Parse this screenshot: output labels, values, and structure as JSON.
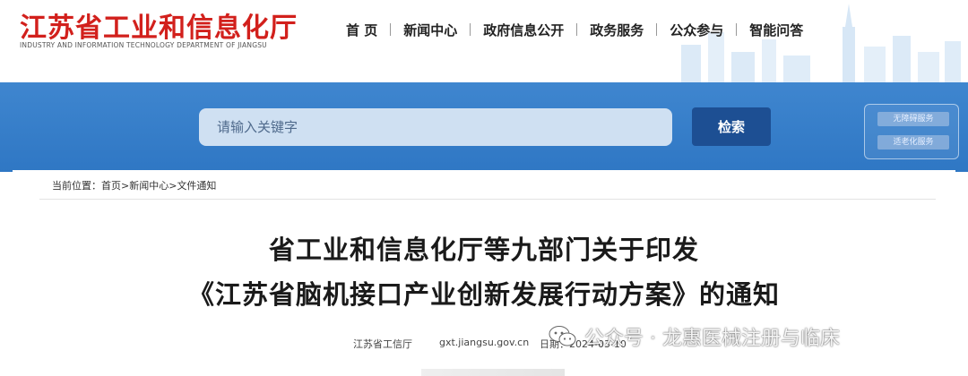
{
  "header": {
    "site_title": "江苏省工业和信息化厅",
    "site_subtitle": "INDUSTRY AND INFORMATION TECHNOLOGY DEPARTMENT OF JIANGSU",
    "nav": [
      "首 页",
      "新闻中心",
      "政府信息公开",
      "政务服务",
      "公众参与",
      "智能问答"
    ]
  },
  "search": {
    "placeholder": "请输入关键字",
    "button_label": "检索"
  },
  "side_links": [
    "无障碍服务",
    "适老化服务"
  ],
  "breadcrumb": {
    "prefix": "当前位置：",
    "items": [
      "首页",
      "新闻中心",
      "文件通知"
    ],
    "sep": ">"
  },
  "article": {
    "title_line1": "省工业和信息化厅等九部门关于印发",
    "title_line2": "《江苏省脑机接口产业创新发展行动方案》的通知",
    "source": "江苏省工信厅",
    "site": "gxt.jiangsu.gov.cn",
    "date_label": "日期：2024-03-10"
  },
  "watermark": {
    "text": "公众号 · 龙惠医械注册与临床",
    "icon": "wechat-icon"
  },
  "colors": {
    "brand_red": "#d2201c",
    "band_blue": "#2f77c4",
    "button_blue": "#1d4f93"
  }
}
